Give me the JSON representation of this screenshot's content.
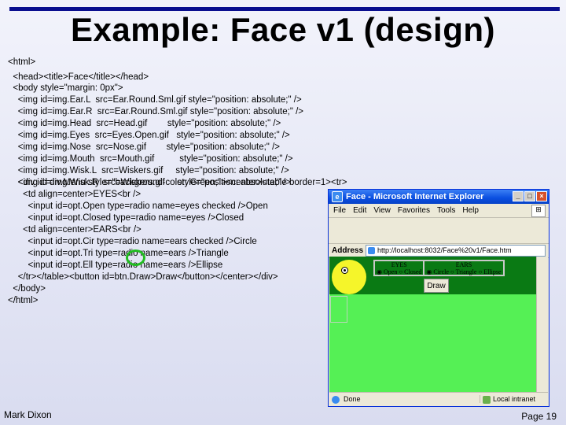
{
  "slide": {
    "title": "Example: Face v1 (design)",
    "author": "Mark Dixon",
    "page": "Page 19"
  },
  "code_lines": [
    "<html>",
    "  <head><title>Face</title></head>",
    "  <body style=\"margin: 0px\">",
    "    <img id=img.Ear.L  src=Ear.Round.Sml.gif style=\"position: absolute;\" />",
    "    <img id=img.Ear.R  src=Ear.Round.Sml.gif style=\"position: absolute;\" />",
    "    <img id=img.Head  src=Head.gif        style=\"position: absolute;\" />",
    "    <img id=img.Eyes  src=Eyes.Open.gif   style=\"position: absolute;\" />",
    "    <img id=img.Nose  src=Nose.gif        style=\"position: absolute;\" />",
    "    <img id=img.Mouth  src=Mouth.gif          style=\"position: absolute;\" />",
    "    <img id=img.Wisk.L  src=Wiskers.gif     style=\"position: absolute;\" />",
    "    <img id=img.Wisk.R  src=Wiskers.gif     style=\"position: absolute;\" />",
    "",
    "    <div id=div.Menu style=\"background-color: Green;\"><center><table border=1><tr>",
    "      <td align=center>EYES<br />",
    "        <input id=opt.Open type=radio name=eyes checked />Open",
    "        <input id=opt.Closed type=radio name=eyes />Closed",
    "      <td align=center>EARS<br />",
    "        <input id=opt.Cir type=radio name=ears checked />Circle",
    "        <input id=opt.Tri type=radio name=ears />Triangle",
    "        <input id=opt.Ell type=radio name=ears />Ellipse",
    "    </tr></table><button id=btn.Draw>Draw</button></center></div>",
    "  </body>",
    "</html>"
  ],
  "browser": {
    "title": "Face - Microsoft Internet Explorer",
    "menu": [
      "File",
      "Edit",
      "View",
      "Favorites",
      "Tools",
      "Help"
    ],
    "address_label": "Address",
    "address_value": "http://localhost:8032/Face%20v1/Face.htm",
    "page": {
      "eyes_header": "EYES",
      "ears_header": "EARS",
      "eyes_options": [
        "Open",
        "Closed"
      ],
      "ears_options": [
        "Circle",
        "Triangle",
        "Ellipse"
      ],
      "draw_label": "Draw"
    },
    "status_text": "Done",
    "zone_text": "Local intranet"
  },
  "colors": {
    "top_bar": "#0a0f8f",
    "menu_green": "#0a7a14",
    "page_green": "#55f055",
    "face_yellow": "#f5f52a",
    "annotation_circle": "#22bb22"
  }
}
